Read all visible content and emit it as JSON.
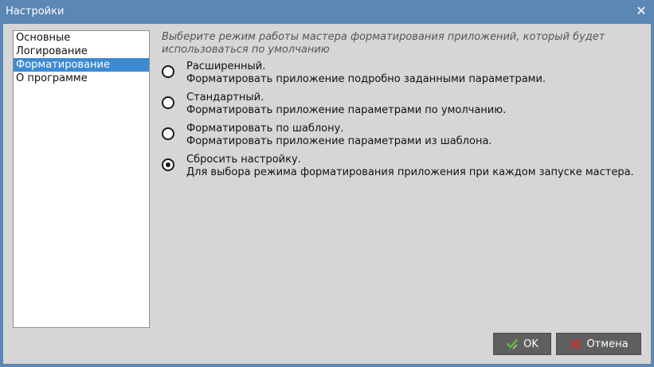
{
  "window": {
    "title": "Настройки",
    "close_glyph": "✕"
  },
  "sidebar": {
    "items": [
      {
        "label": "Основные",
        "selected": false
      },
      {
        "label": "Логирование",
        "selected": false
      },
      {
        "label": "Форматирование",
        "selected": true
      },
      {
        "label": "О программе",
        "selected": false
      }
    ]
  },
  "main": {
    "hint_line1": "Выберите режим работы мастера форматирования приложений, который будет",
    "hint_line2": "использоваться по умолчанию",
    "options": [
      {
        "title": "Расширенный.",
        "description": "Форматировать приложение подробно заданными параметрами.",
        "checked": false
      },
      {
        "title": "Стандартный.",
        "description": "Форматировать приложение параметрами по умолчанию.",
        "checked": false
      },
      {
        "title": "Форматировать по шаблону.",
        "description": "Форматировать приложение параметрами из шаблона.",
        "checked": false
      },
      {
        "title": "Сбросить настройку.",
        "description": "Для выбора режима форматирования приложения при каждом запуске мастера.",
        "checked": true
      }
    ]
  },
  "buttons": {
    "ok_label": "OK",
    "ok_icon": "check-pen-icon",
    "cancel_label": "Отмена",
    "cancel_icon": "cross-pen-icon"
  },
  "colors": {
    "titlebar": "#5a87b4",
    "selection": "#3c8ad0",
    "button": "#5f5f5f",
    "ok_icon": "#5bbf3a",
    "cancel_icon": "#d9342b"
  }
}
